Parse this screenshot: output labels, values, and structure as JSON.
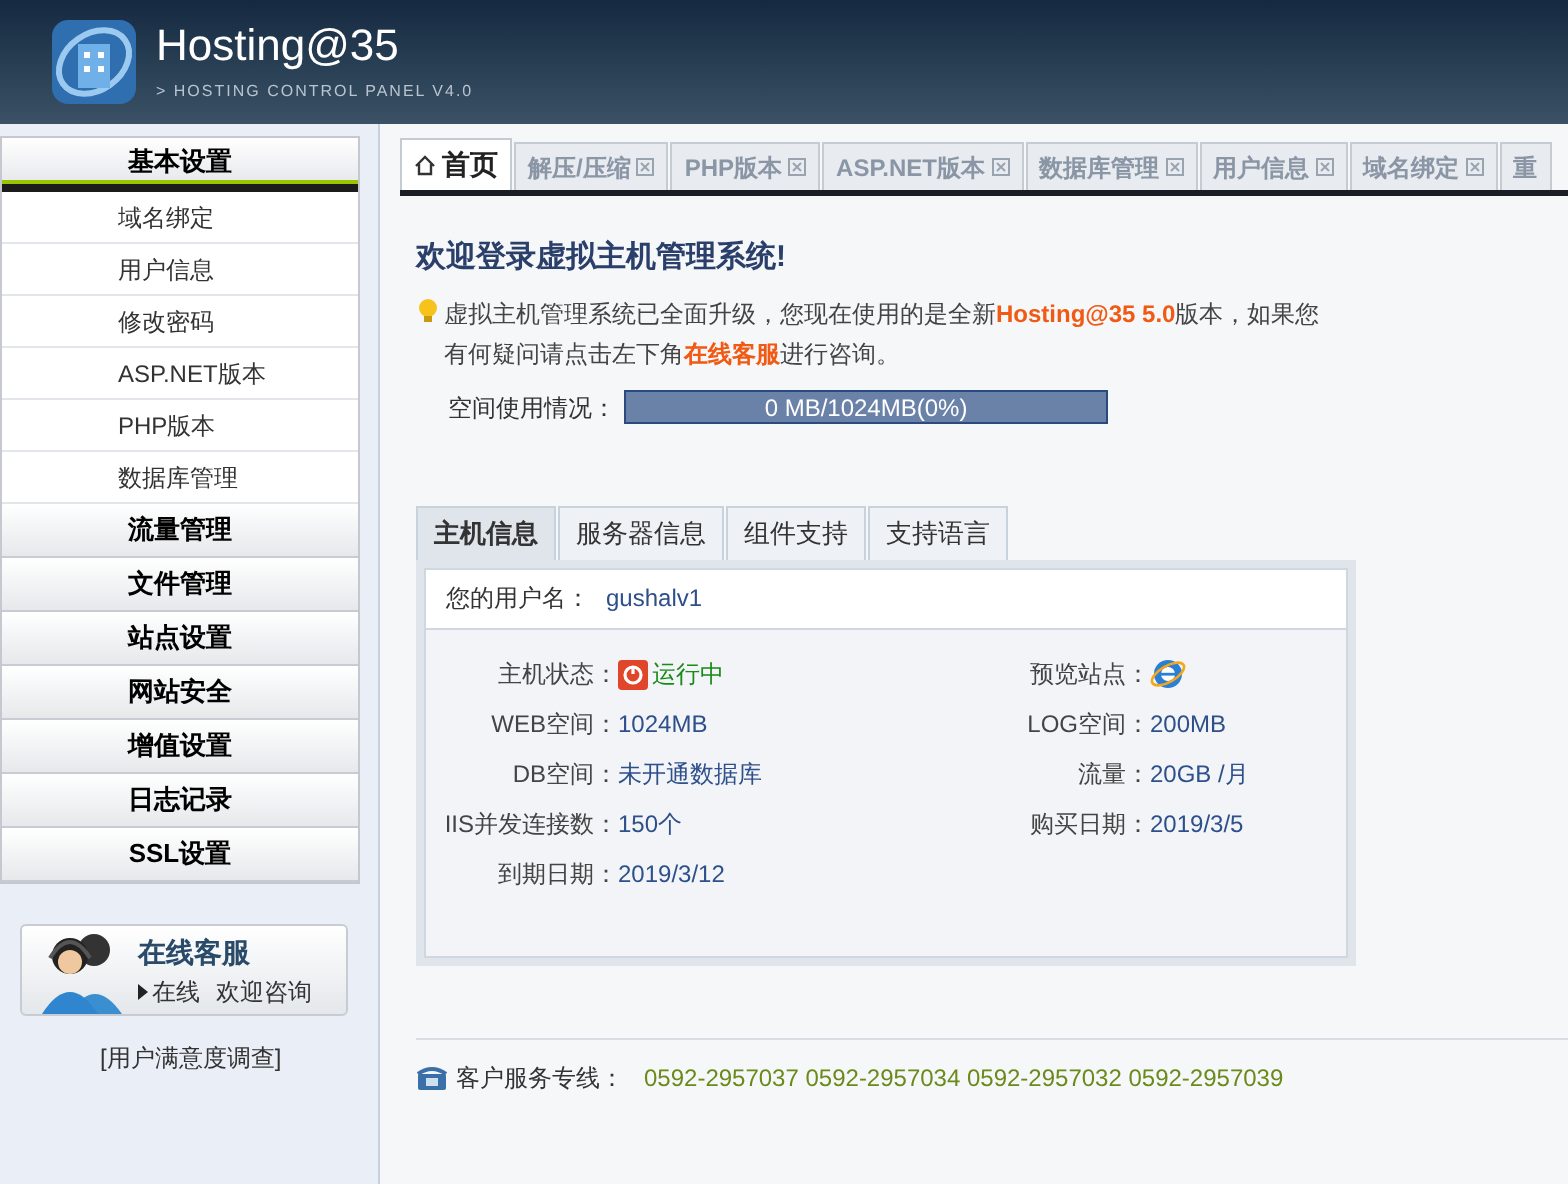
{
  "header": {
    "brand": "Hosting@35",
    "subtitle": "> HOSTING CONTROL PANEL V4.0"
  },
  "sidebar": {
    "sections": [
      {
        "label": "基本设置",
        "expanded": true,
        "children": [
          "域名绑定",
          "用户信息",
          "修改密码",
          "ASP.NET版本",
          "PHP版本",
          "数据库管理"
        ]
      },
      {
        "label": "流量管理",
        "expanded": false
      },
      {
        "label": "文件管理",
        "expanded": false
      },
      {
        "label": "站点设置",
        "expanded": false
      },
      {
        "label": "网站安全",
        "expanded": false
      },
      {
        "label": "增值设置",
        "expanded": false
      },
      {
        "label": "日志记录",
        "expanded": false
      },
      {
        "label": "SSL设置",
        "expanded": false
      }
    ],
    "support": {
      "title": "在线客服",
      "status": "在线",
      "note": "欢迎咨询"
    },
    "survey": "[用户满意度调查]"
  },
  "tabs": [
    {
      "label": "首页",
      "selected": true,
      "closable": false
    },
    {
      "label": "解压/压缩",
      "selected": false,
      "closable": true
    },
    {
      "label": "PHP版本",
      "selected": false,
      "closable": true
    },
    {
      "label": "ASP.NET版本",
      "selected": false,
      "closable": true
    },
    {
      "label": "数据库管理",
      "selected": false,
      "closable": true
    },
    {
      "label": "用户信息",
      "selected": false,
      "closable": true
    },
    {
      "label": "域名绑定",
      "selected": false,
      "closable": true
    },
    {
      "label": "重",
      "selected": false,
      "closable": false
    }
  ],
  "welcome": {
    "title": "欢迎登录虚拟主机管理系统!",
    "notice": "虚拟主机管理系统已全面升级，您现在使用的是全新",
    "product": "Hosting@35 5.0",
    "notice_2": "版本，如果您",
    "notice_3": "有何疑问请点击左下角",
    "link": "在线客服",
    "notice_4": "进行咨询。"
  },
  "usage": {
    "label": "空间使用情况：",
    "reading": "0 MB/1024MB(0%)",
    "level": 0
  },
  "info_tabs": [
    {
      "label": "主机信息",
      "selected": true
    },
    {
      "label": "服务器信息",
      "selected": false
    },
    {
      "label": "组件支持",
      "selected": false
    },
    {
      "label": "支持语言",
      "selected": false
    }
  ],
  "account": {
    "label": "您的用户名：",
    "value": "gushalv1"
  },
  "fields": [
    {
      "kind": "status",
      "label": "主机状态：",
      "value": "运行中"
    },
    {
      "kind": "browser",
      "label": "预览站点："
    },
    {
      "kind": "text",
      "label": "WEB空间：",
      "value": "1024MB"
    },
    {
      "kind": "text",
      "label": "LOG空间：",
      "value": "200MB"
    },
    {
      "kind": "text",
      "label": "DB空间：",
      "value": "未开通数据库"
    },
    {
      "kind": "text",
      "label": "流量：",
      "value": "20GB /月"
    },
    {
      "kind": "text",
      "label": "IIS并发连接数：",
      "value": "150个"
    },
    {
      "kind": "text",
      "label": "购买日期：",
      "value": "2019/3/5"
    },
    {
      "kind": "text",
      "label": "到期日期：",
      "value": "2019/3/12"
    }
  ],
  "footer": {
    "label": "客户服务专线：",
    "phones": "0592-2957037 0592-2957034 0592-2957032 0592-2957039"
  }
}
